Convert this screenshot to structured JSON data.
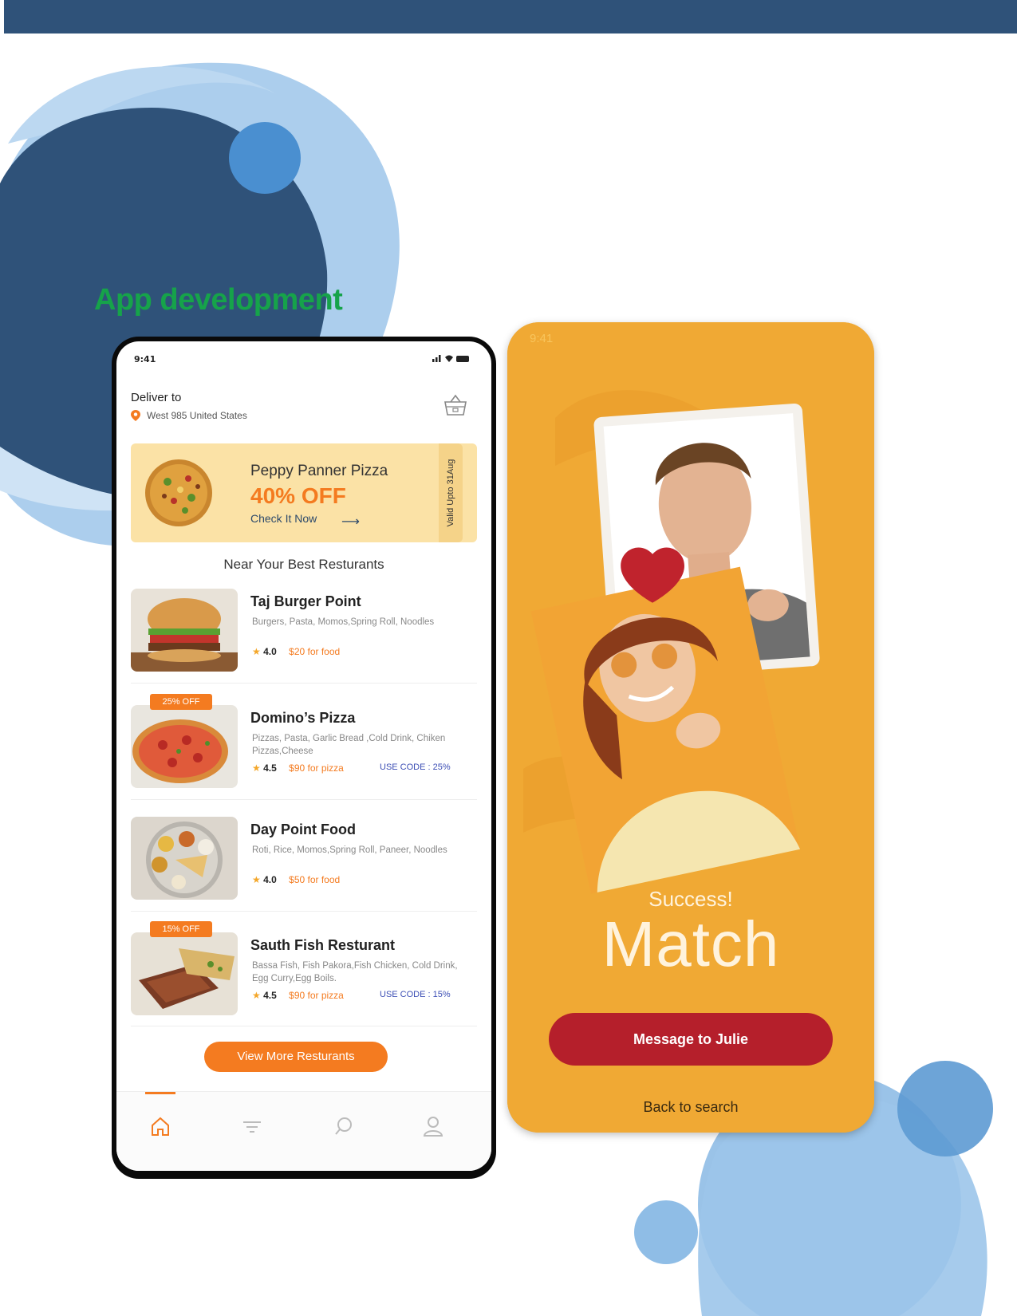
{
  "colors": {
    "header_bar": "#2f5279",
    "title_green": "#16a34a",
    "accent_orange": "#f47b20",
    "match_bg": "#f0a934",
    "button_red": "#b51f2b",
    "deco_dark_blue": "#2f5279",
    "deco_light_blue": "#8fbde6"
  },
  "section_title": "App development",
  "food_app": {
    "status_time": "9:41",
    "deliver_label": "Deliver to",
    "address": "West 985 United States",
    "icons": {
      "location": "map-pin-icon",
      "basket": "basket-icon",
      "arrow": "arrow-right-icon"
    },
    "banner": {
      "title": "Peppy Panner Pizza",
      "discount": "40% OFF",
      "link": "Check It Now",
      "side_text": "Valid Upto 31Aug"
    },
    "section_heading": "Near Your Best Resturants",
    "restaurants": [
      {
        "name": "Taj Burger Point",
        "cuisines": "Burgers, Pasta, Momos,Spring Roll, Noodles",
        "rating": "4.0",
        "price": "$20 for food",
        "badge": "",
        "code": ""
      },
      {
        "name": "Domino’s Pizza",
        "cuisines": "Pizzas, Pasta, Garlic Bread ,Cold Drink, Chiken Pizzas,Cheese",
        "rating": "4.5",
        "price": "$90 for pizza",
        "badge": "25% OFF",
        "code": "USE CODE : 25%"
      },
      {
        "name": "Day Point Food",
        "cuisines": "Roti, Rice, Momos,Spring Roll, Paneer, Noodles",
        "rating": "4.0",
        "price": "$50 for food",
        "badge": "",
        "code": ""
      },
      {
        "name": "Sauth Fish Resturant",
        "cuisines": "Bassa Fish, Fish Pakora,Fish Chicken, Cold Drink, Egg Curry,Egg Boils.",
        "rating": "4.5",
        "price": "$90 for pizza",
        "badge": "15% OFF",
        "code": "USE CODE : 15%"
      }
    ],
    "view_more": "View More Resturants",
    "nav_icons": [
      "home-icon",
      "filter-icon",
      "search-icon",
      "profile-icon"
    ],
    "active_nav": "home"
  },
  "dating_app": {
    "status_time": "9:41",
    "success_text": "Success!",
    "match_text": "Match",
    "message_button": "Message to Julie",
    "back_link": "Back to search",
    "icons": {
      "heart": "heart-icon"
    }
  }
}
